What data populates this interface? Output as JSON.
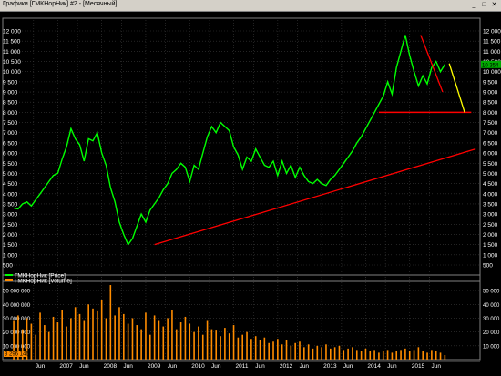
{
  "window": {
    "title": "Графики [ГМКНорНик] #2 - [Месячный]",
    "buttons": {
      "minimize": "_",
      "maximize": "□",
      "close": "✕"
    }
  },
  "colors": {
    "background": "#000000",
    "price_line": "#00ff00",
    "trendline": "#ff0000",
    "forecast_line": "#ffff00",
    "volume_bars": "#ff8c00",
    "grid": "#3a3a3a",
    "axis_text": "#ffffff",
    "price_label_bg": "#00aa00",
    "volume_label_bg": "#ff8c00"
  },
  "chart_data": [
    {
      "type": "line",
      "legend": [
        "ГМКНорНик [Price]"
      ],
      "price_axis_ticks": [
        "12 000",
        "11 500",
        "11 000",
        "10 500",
        "10 000",
        "9 500",
        "9 000",
        "8 500",
        "8 000",
        "7 500",
        "7 000",
        "6 500",
        "6 000",
        "5 500",
        "5 000",
        "4 500",
        "4 000",
        "3 500",
        "3 000",
        "2 500",
        "2 000",
        "1 500",
        "1 000",
        "500"
      ],
      "ylim": [
        500,
        12000
      ],
      "grid": true,
      "current_price_label": "10 354",
      "series": [
        {
          "name": "ГМКНорНик [Price]",
          "x": [
            2006.0,
            2006.1,
            2006.2,
            2006.3,
            2006.4,
            2006.5,
            2006.6,
            2006.7,
            2006.8,
            2006.9,
            2007.0,
            2007.1,
            2007.2,
            2007.3,
            2007.4,
            2007.5,
            2007.6,
            2007.7,
            2007.8,
            2007.9,
            2008.0,
            2008.1,
            2008.2,
            2008.3,
            2008.4,
            2008.5,
            2008.6,
            2008.7,
            2008.8,
            2008.9,
            2009.0,
            2009.1,
            2009.2,
            2009.3,
            2009.4,
            2009.5,
            2009.6,
            2009.7,
            2009.8,
            2009.9,
            2010.0,
            2010.1,
            2010.2,
            2010.3,
            2010.4,
            2010.5,
            2010.6,
            2010.7,
            2010.8,
            2010.9,
            2011.0,
            2011.1,
            2011.2,
            2011.3,
            2011.4,
            2011.5,
            2011.6,
            2011.7,
            2011.8,
            2011.9,
            2012.0,
            2012.1,
            2012.2,
            2012.3,
            2012.4,
            2012.5,
            2012.6,
            2012.7,
            2012.8,
            2012.9,
            2013.0,
            2013.1,
            2013.2,
            2013.3,
            2013.4,
            2013.5,
            2013.6,
            2013.7,
            2013.8,
            2013.9,
            2014.0,
            2014.1,
            2014.2,
            2014.3,
            2014.4,
            2014.5,
            2014.6,
            2014.7,
            2014.8,
            2014.9,
            2015.0,
            2015.1,
            2015.2,
            2015.3,
            2015.4,
            2015.5,
            2015.6,
            2015.7,
            2015.8
          ],
          "values": [
            3300,
            3250,
            3500,
            3600,
            3400,
            3700,
            4000,
            4300,
            4600,
            4900,
            5000,
            5700,
            6300,
            7200,
            6700,
            6400,
            5600,
            6700,
            6600,
            7000,
            6000,
            5400,
            4300,
            3600,
            2600,
            2000,
            1500,
            1800,
            2400,
            3000,
            2600,
            3200,
            3500,
            3800,
            4200,
            4500,
            5000,
            5200,
            5500,
            5300,
            4600,
            5400,
            5200,
            6000,
            6800,
            7300,
            7000,
            7500,
            7300,
            7100,
            6300,
            5900,
            5200,
            5800,
            5600,
            6200,
            5800,
            5400,
            5300,
            5600,
            4900,
            5600,
            5000,
            5400,
            4800,
            5300,
            4900,
            4600,
            4500,
            4700,
            4500,
            4400,
            4700,
            4900,
            5200,
            5500,
            5800,
            6100,
            6500,
            6800,
            7200,
            7600,
            8000,
            8400,
            8800,
            9500,
            8900,
            10200,
            11000,
            11800,
            10800,
            10000,
            9300,
            9800,
            9400,
            10200,
            10500,
            10000,
            10354
          ]
        }
      ],
      "annotations": [
        {
          "type": "trendline",
          "color": "#ff0000",
          "from": [
            2009.2,
            1500
          ],
          "to": [
            2016.5,
            6200
          ]
        },
        {
          "type": "horizontal",
          "color": "#ff0000",
          "y": 8000,
          "from_x": 2014.3,
          "to_x": 2016.4
        },
        {
          "type": "trendline",
          "color": "#ff0000",
          "from": [
            2015.25,
            11800
          ],
          "to": [
            2015.75,
            9000
          ]
        },
        {
          "type": "trendline",
          "color": "#ffff00",
          "from": [
            2015.9,
            10400
          ],
          "to": [
            2016.25,
            8000
          ]
        }
      ]
    },
    {
      "type": "bar",
      "legend": [
        "ГМКНорНик [Volume]"
      ],
      "volume_axis_ticks": [
        "50 000 000",
        "40 000 000",
        "30 000 000",
        "20 000 000",
        "10 000 000"
      ],
      "ylim": [
        0,
        56000000
      ],
      "current_volume_label": "3 296 146",
      "x_axis_labels": [
        "Jun",
        "2007",
        "Jun",
        "2008",
        "Jun",
        "2009",
        "Jun",
        "2010",
        "Jun",
        "2011",
        "Jun",
        "2012",
        "Jun",
        "2013",
        "Jun",
        "2014",
        "Jun",
        "2015",
        "Jun"
      ],
      "x_axis_values": [
        2006.45,
        2007.0,
        2007.45,
        2008.0,
        2008.45,
        2009.0,
        2009.45,
        2010.0,
        2010.45,
        2011.0,
        2011.45,
        2012.0,
        2012.45,
        2013.0,
        2013.45,
        2014.0,
        2014.45,
        2015.0,
        2015.45
      ],
      "series": [
        {
          "name": "ГМКНорНик [Volume]",
          "values": [
            28000000,
            32000000,
            22000000,
            30000000,
            26000000,
            18000000,
            34000000,
            25000000,
            20000000,
            31000000,
            27000000,
            36000000,
            24000000,
            30000000,
            38000000,
            33000000,
            28000000,
            40000000,
            37000000,
            35000000,
            43000000,
            30000000,
            54000000,
            32000000,
            38000000,
            33000000,
            26000000,
            30000000,
            25000000,
            22000000,
            34000000,
            18000000,
            32000000,
            28000000,
            24000000,
            30000000,
            36000000,
            22000000,
            27000000,
            31000000,
            26000000,
            20000000,
            24000000,
            18000000,
            28000000,
            22000000,
            21000000,
            17000000,
            23000000,
            19000000,
            25000000,
            16000000,
            18000000,
            20000000,
            15000000,
            17000000,
            14000000,
            16000000,
            12000000,
            13000000,
            15000000,
            11000000,
            14000000,
            10000000,
            12000000,
            13000000,
            9000000,
            11000000,
            8000000,
            10000000,
            9000000,
            11000000,
            8000000,
            9000000,
            10000000,
            7000000,
            8000000,
            9000000,
            7000000,
            6000000,
            8000000,
            6000000,
            7000000,
            5000000,
            6000000,
            7000000,
            5000000,
            6000000,
            7000000,
            8000000,
            6000000,
            7000000,
            9000000,
            6000000,
            5000000,
            7000000,
            6000000,
            5000000,
            3296146
          ]
        }
      ]
    }
  ]
}
